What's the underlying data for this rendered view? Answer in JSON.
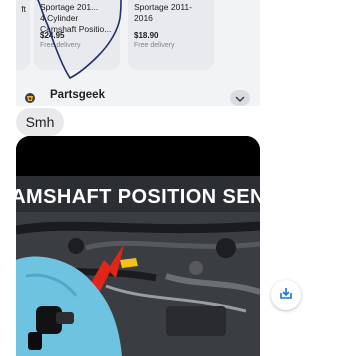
{
  "shared_card": {
    "products": [
      {
        "title": "ft",
        "price": "",
        "shipping": ""
      },
      {
        "title": "Sportage 201...\n4 Cylinder\nCamshaft Positio...",
        "price": "$24.95",
        "shipping": "Free delivery"
      },
      {
        "title": "Sportage 2011-\n2016",
        "price": "$18.90",
        "shipping": "Free delivery"
      }
    ],
    "source_name": "Partsgeek",
    "icons": {
      "logo": "partsgeek-logo-icon",
      "expand": "chevron-down-icon"
    }
  },
  "message": {
    "text": "Smh"
  },
  "video": {
    "caption": "AMSHAFT POSITION SEN"
  },
  "download": {
    "icon": "save-download-icon"
  },
  "colors": {
    "card_bg": "#f1f3f4",
    "bubble_bg": "#e9e9eb",
    "scribble": "#23306b",
    "arrow": "#e0261b",
    "glove": "#6ec3e0"
  }
}
